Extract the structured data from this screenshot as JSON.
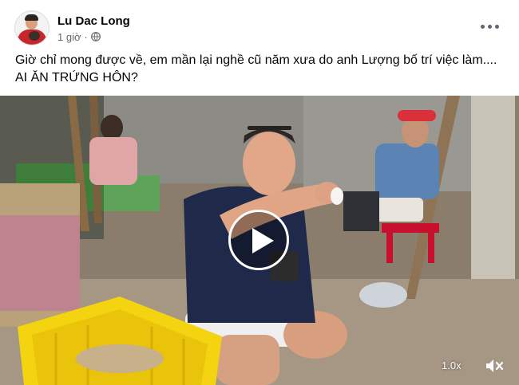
{
  "post": {
    "author": "Lu Dac Long",
    "time": "1 giờ",
    "separator": "·",
    "privacy_icon": "globe-icon",
    "more_icon": "more-horizontal-icon",
    "text_line1": "Giờ chỉ mong được về, em mần lại nghề cũ năm xưa do anh Lượng bố trí việc làm....",
    "text_line2": "AI ĂN TRỨNG HÔN?"
  },
  "video": {
    "play_icon": "play-icon",
    "speed": "1.0x",
    "volume_icon": "muted-speaker-icon",
    "colors": {
      "crate": "#f4d311",
      "shirt": "#1f2a4a",
      "stool": "#c8102e",
      "cap": "#d9303a"
    }
  }
}
